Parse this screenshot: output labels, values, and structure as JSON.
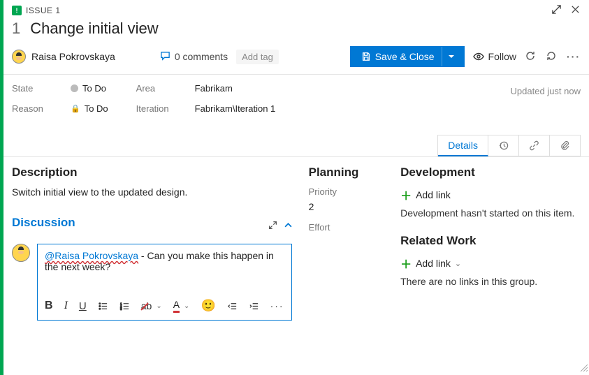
{
  "header": {
    "issue_label": "ISSUE 1",
    "id": "1",
    "title": "Change initial view"
  },
  "assignee": {
    "name": "Raisa Pokrovskaya"
  },
  "toolbar": {
    "comments_count": "0 comments",
    "add_tag": "Add tag",
    "save_label": "Save & Close",
    "follow_label": "Follow"
  },
  "fields": {
    "state_label": "State",
    "state_value": "To Do",
    "reason_label": "Reason",
    "reason_value": "To Do",
    "area_label": "Area",
    "area_value": "Fabrikam",
    "iteration_label": "Iteration",
    "iteration_value": "Fabrikam\\Iteration 1",
    "updated": "Updated just now"
  },
  "tabs": {
    "details": "Details"
  },
  "description": {
    "heading": "Description",
    "text": "Switch initial view to the updated design."
  },
  "discussion": {
    "heading": "Discussion",
    "mention": "@Raisa Pokrovskaya",
    "text": " - Can you make this happen in the next week?"
  },
  "planning": {
    "heading": "Planning",
    "priority_label": "Priority",
    "priority_value": "2",
    "effort_label": "Effort"
  },
  "development": {
    "heading": "Development",
    "add_link": "Add link",
    "empty": "Development hasn't started on this item."
  },
  "related": {
    "heading": "Related Work",
    "add_link": "Add link",
    "empty": "There are no links in this group."
  }
}
